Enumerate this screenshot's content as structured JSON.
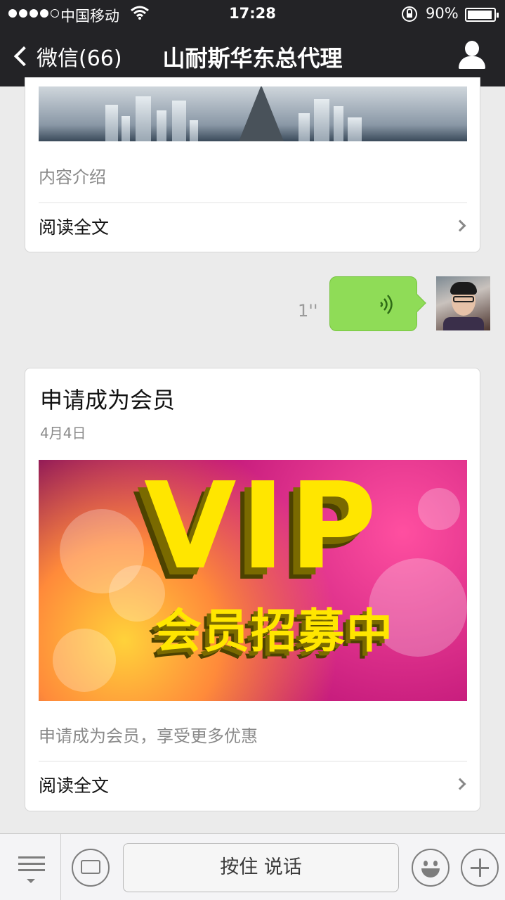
{
  "status_bar": {
    "carrier": "中国移动",
    "time": "17:28",
    "battery_percent": "90%",
    "battery_level": 0.9,
    "icons": [
      "signal-dots-icon",
      "wifi-icon",
      "orientation-lock-icon",
      "battery-icon"
    ]
  },
  "nav": {
    "back_label": "微信(66)",
    "title": "山耐斯华东总代理",
    "right_icon": "profile-icon"
  },
  "messages": {
    "article1": {
      "description": "内容介绍",
      "read_more": "阅读全文"
    },
    "voice": {
      "duration": "1''",
      "icon": "voice-wave-icon"
    },
    "article2": {
      "title": "申请成为会员",
      "date": "4月4日",
      "image_text_main": "VIP",
      "image_text_sub": "会员招募中",
      "description": "申请成为会员，享受更多优惠",
      "read_more": "阅读全文"
    }
  },
  "bottom_bar": {
    "hold_to_talk": "按住 说话",
    "icons": [
      "menu-icon",
      "keyboard-icon",
      "emoji-icon",
      "plus-icon"
    ]
  },
  "colors": {
    "nav_bg": "#232326",
    "page_bg": "#ebebeb",
    "voice_bubble": "#8fdc57",
    "vip_yellow": "#ffe600"
  }
}
